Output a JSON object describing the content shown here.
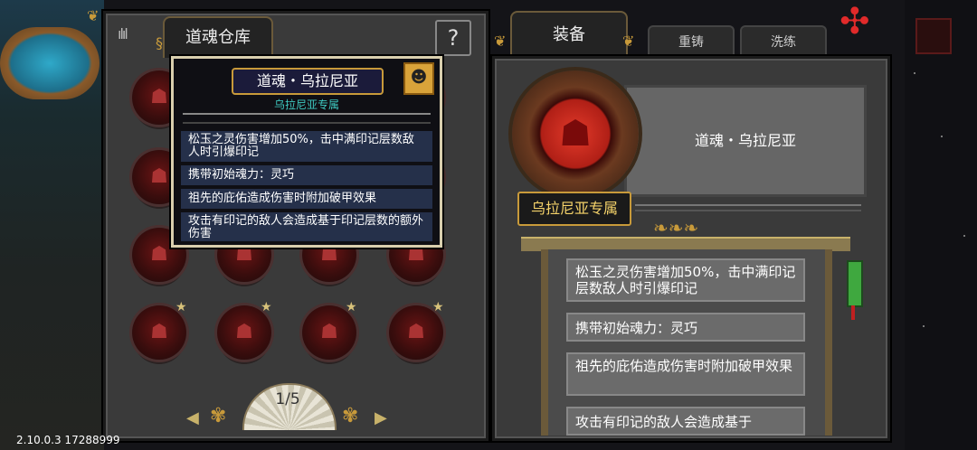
{
  "warehouse": {
    "tab_label": "道魂仓库",
    "help_label": "?",
    "page_indicator": "1/5",
    "items": [
      {
        "id": "r1c1",
        "star": false
      },
      {
        "id": "r1c2",
        "star": false
      },
      {
        "id": "r1c3",
        "star": false
      },
      {
        "id": "r1c4",
        "star": false
      },
      {
        "id": "r2c1",
        "star": false
      },
      {
        "id": "r2c2",
        "star": false
      },
      {
        "id": "r2c3",
        "star": false
      },
      {
        "id": "r2c4",
        "star": false
      },
      {
        "id": "r3c1",
        "star": false
      },
      {
        "id": "r3c2",
        "star": false
      },
      {
        "id": "r3c3",
        "star": false
      },
      {
        "id": "r3c4",
        "star": false
      },
      {
        "id": "r4c1",
        "star": true
      },
      {
        "id": "r4c2",
        "star": true
      },
      {
        "id": "r4c3",
        "star": true
      },
      {
        "id": "r4c4",
        "star": true
      }
    ]
  },
  "tooltip": {
    "title": "道魂・乌拉尼亚",
    "subtitle": "乌拉尼亚专属",
    "effects": [
      "松玉之灵伤害增加50%，击中满印记层数敌人时引爆印记",
      "携带初始魂力：灵巧",
      "祖先的庇佑造成伤害时附加破甲效果",
      "攻击有印记的敌人会造成基于印记层数的额外伤害"
    ]
  },
  "equipment": {
    "tabs": {
      "equip": "装备",
      "reforge": "重铸",
      "refine": "洗练"
    },
    "item_name": "道魂・乌拉尼亚",
    "exclusive_label": "乌拉尼亚专属",
    "effects": [
      "松玉之灵伤害增加50%，击中满印记层数敌人时引爆印记",
      "携带初始魂力：灵巧",
      "祖先的庇佑造成伤害时附加破甲效果",
      "攻击有印记的敌人会造成基于"
    ]
  },
  "version_text": "2.10.0.3 17288999",
  "colors": {
    "accent_gold": "#c89a3a",
    "orb_red": "#b01f16",
    "tooltip_bg": "#0f0f14"
  },
  "icons": {
    "star": "★",
    "scroll_left": "◀",
    "scroll_right": "▶",
    "pinwheel": "✣"
  }
}
